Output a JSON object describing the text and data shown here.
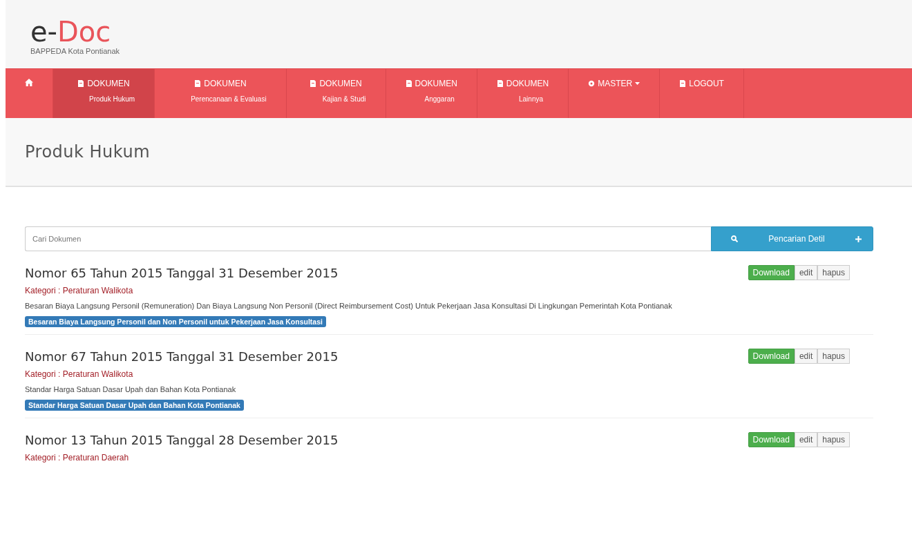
{
  "brand": {
    "logo_prefix": "e-",
    "logo_main": "Doc",
    "subtitle": "BAPPEDA Kota Pontianak"
  },
  "nav": [
    {
      "kind": "home",
      "selected": false
    },
    {
      "kind": "doc",
      "label": "DOKUMEN",
      "sublabel": "Produk Hukum",
      "selected": true
    },
    {
      "kind": "doc",
      "label": "DOKUMEN",
      "sublabel": "Perencanaan & Evaluasi",
      "selected": false
    },
    {
      "kind": "doc",
      "label": "DOKUMEN",
      "sublabel": "Kajian & Studi",
      "selected": false
    },
    {
      "kind": "doc",
      "label": "DOKUMEN",
      "sublabel": "Anggaran",
      "selected": false
    },
    {
      "kind": "doc",
      "label": "DOKUMEN",
      "sublabel": "Lainnya",
      "selected": false
    },
    {
      "kind": "master",
      "label": "MASTER",
      "selected": false
    },
    {
      "kind": "doc",
      "label": "LOGOUT",
      "selected": false
    }
  ],
  "page_title": "Produk Hukum",
  "search": {
    "placeholder": "Cari Dokumen",
    "button": "Pencarian Detil"
  },
  "documents": [
    {
      "title": "Nomor 65 Tahun 2015 Tanggal 31 Desember 2015",
      "category": "Kategori : Peraturan Walikota",
      "description": "Besaran Biaya Langsung Personil (Remuneration) Dan Biaya Langsung Non Personil (Direct Reimbursement Cost) Untuk Pekerjaan Jasa Konsultasi Di Lingkungan Pemerintah Kota Pontianak",
      "tag": "Besaran Biaya Langsung Personil dan Non Personil untuk Pekerjaan Jasa Konsultasi",
      "actions": [
        "Download",
        "edit",
        "hapus"
      ]
    },
    {
      "title": "Nomor 67 Tahun 2015 Tanggal 31 Desember 2015",
      "category": "Kategori : Peraturan Walikota",
      "description": "Standar Harga Satuan Dasar Upah dan Bahan Kota Pontianak",
      "tag": "Standar Harga Satuan Dasar Upah dan Bahan Kota Pontianak",
      "actions": [
        "Download",
        "edit",
        "hapus"
      ]
    },
    {
      "title": "Nomor 13 Tahun 2015 Tanggal 28 Desember 2015",
      "category": "Kategori : Peraturan Daerah",
      "actions": [
        "Download",
        "edit",
        "hapus"
      ]
    }
  ]
}
